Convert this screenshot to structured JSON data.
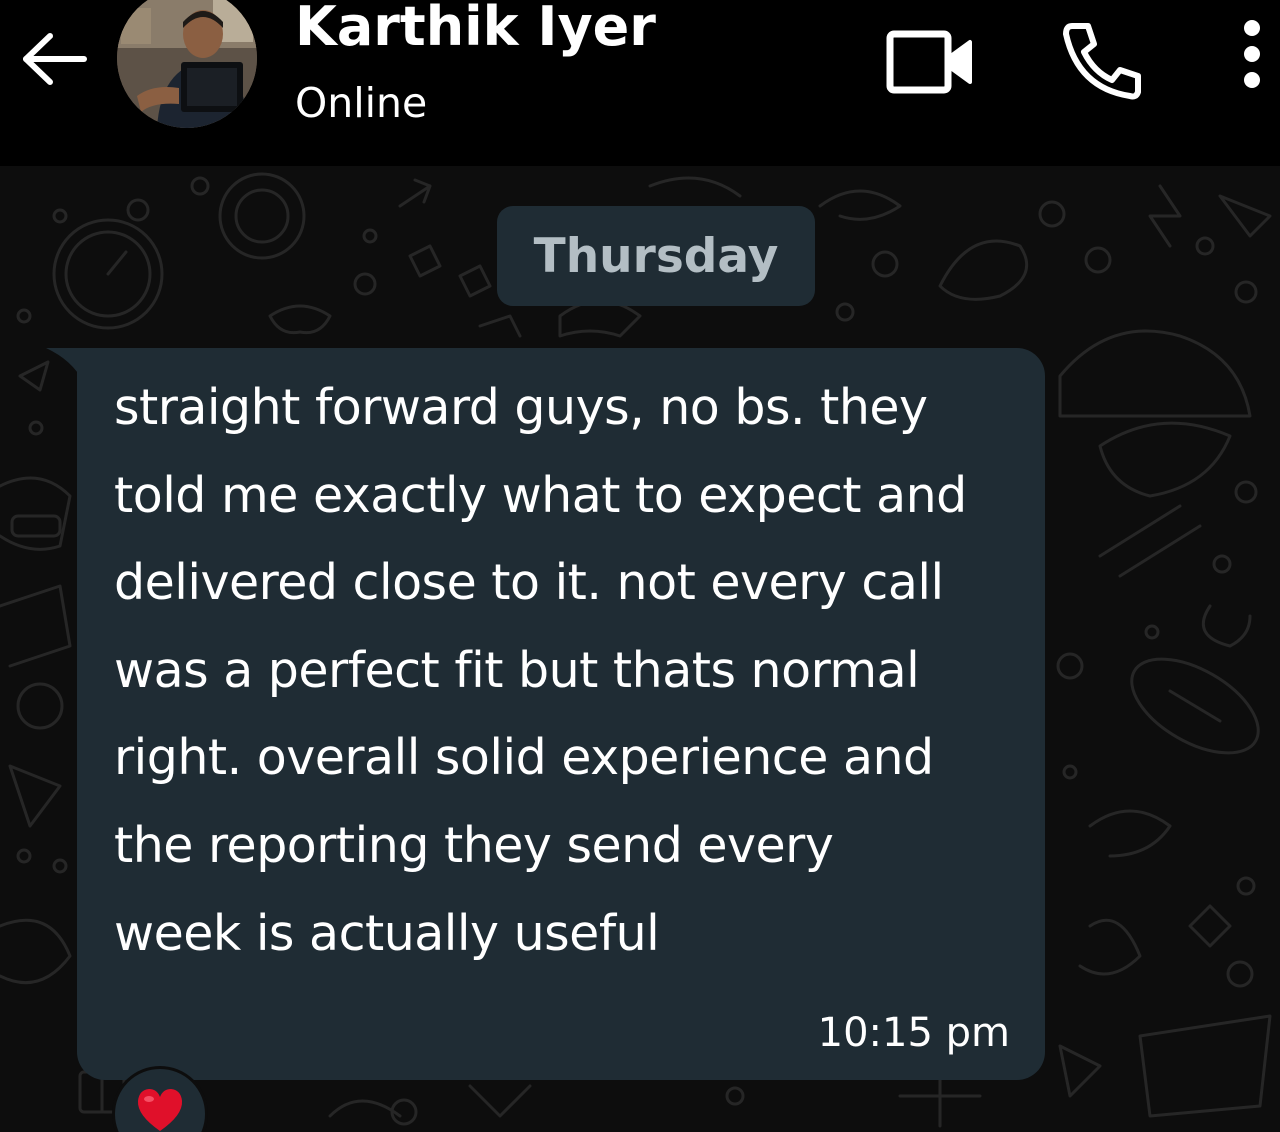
{
  "header": {
    "contact_name": "Karthik Iyer",
    "status": "Online",
    "back_icon": "arrow-left-icon",
    "video_icon": "video-call-icon",
    "call_icon": "phone-icon",
    "menu_icon": "more-vert-icon"
  },
  "chat": {
    "date_label": "Thursday",
    "message": {
      "lines": [
        "straight forward guys, no bs. they",
        "told me exactly what to expect and",
        "delivered close to it. not every call",
        "was a perfect fit but thats normal",
        "right. overall solid experience and",
        "the reporting they send every",
        "week is actually useful"
      ],
      "time": "10:15 pm",
      "reaction": "heart-emoji"
    }
  },
  "colors": {
    "header_bg": "#000000",
    "chat_bg": "#0d0d0d",
    "bubble_bg": "#1f2c34",
    "date_chip_text": "#b3bec4",
    "text": "#ffffff",
    "reaction_heart": "#e0102a"
  }
}
